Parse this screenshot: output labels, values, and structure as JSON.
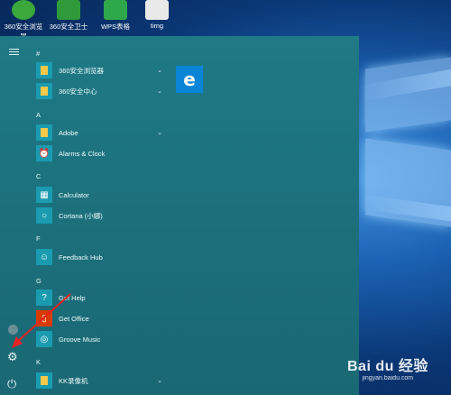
{
  "desktop": {
    "icons": [
      {
        "label": "360安全浏览\n器",
        "icon": "360-browser-icon",
        "color": "#3aa83a"
      },
      {
        "label": "360安全卫士",
        "icon": "360-security-icon",
        "color": "#2f9a3a"
      },
      {
        "label": "WPS表格",
        "icon": "wps-sheet-icon",
        "color": "#2ea84a"
      },
      {
        "label": "timg",
        "icon": "image-file-icon",
        "color": "#e9e9e9"
      }
    ]
  },
  "start_menu": {
    "sections": [
      {
        "letter": "#",
        "items": [
          {
            "label": "360安全浏览器",
            "icon": "folder-icon",
            "expandable": true
          },
          {
            "label": "360安全中心",
            "icon": "folder-icon",
            "expandable": true
          }
        ]
      },
      {
        "letter": "A",
        "items": [
          {
            "label": "Adobe",
            "icon": "folder-icon",
            "expandable": true
          },
          {
            "label": "Alarms & Clock",
            "icon": "alarm-clock-icon",
            "expandable": false
          }
        ]
      },
      {
        "letter": "C",
        "items": [
          {
            "label": "Calculator",
            "icon": "calculator-icon",
            "expandable": false
          },
          {
            "label": "Cortana (小娜)",
            "icon": "cortana-icon",
            "expandable": false
          }
        ]
      },
      {
        "letter": "F",
        "items": [
          {
            "label": "Feedback Hub",
            "icon": "feedback-icon",
            "expandable": false
          }
        ]
      },
      {
        "letter": "G",
        "items": [
          {
            "label": "Get Help",
            "icon": "help-icon",
            "expandable": false
          },
          {
            "label": "Get Office",
            "icon": "office-icon",
            "expandable": false
          },
          {
            "label": "Groove Music",
            "icon": "music-icon",
            "expandable": false
          }
        ]
      },
      {
        "letter": "K",
        "items": [
          {
            "label": "KK录像机",
            "icon": "folder-icon",
            "expandable": true
          }
        ]
      }
    ],
    "tiles": [
      {
        "name": "edge",
        "glyph": "e",
        "color": "#0a84d6"
      }
    ]
  },
  "watermark": {
    "brand": "Bai du 经验",
    "url": "jingyan.baidu.com"
  },
  "colors": {
    "accent": "#1a9bb0",
    "menu_bg": "#1f7a86",
    "annotation_arrow": "#e52222"
  }
}
